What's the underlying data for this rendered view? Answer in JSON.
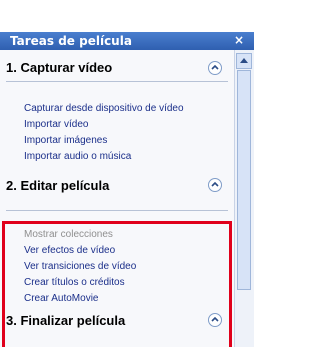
{
  "panel": {
    "title": "Tareas de película",
    "close": "×"
  },
  "sections": [
    {
      "title": "1. Capturar vídeo",
      "items": [
        {
          "label": "Capturar desde dispositivo de vídeo"
        },
        {
          "label": "Importar vídeo"
        },
        {
          "label": "Importar imágenes"
        },
        {
          "label": "Importar audio o música"
        }
      ]
    },
    {
      "title": "2. Editar película",
      "items": [
        {
          "label": "Mostrar colecciones",
          "state": "disabled"
        },
        {
          "label": "Ver efectos de vídeo"
        },
        {
          "label": "Ver transiciones de vídeo"
        },
        {
          "label": "Crear títulos o créditos"
        },
        {
          "label": "Crear AutoMovie"
        }
      ]
    },
    {
      "title": "3. Finalizar película",
      "items": []
    }
  ],
  "colors": {
    "titlebar": "#3d6fc0",
    "link": "#1b2f8a",
    "disabled": "#8f8f8f",
    "highlight": "#e0001b"
  },
  "icons": {
    "collapse": "chevron-up-icon",
    "close": "close-icon"
  }
}
